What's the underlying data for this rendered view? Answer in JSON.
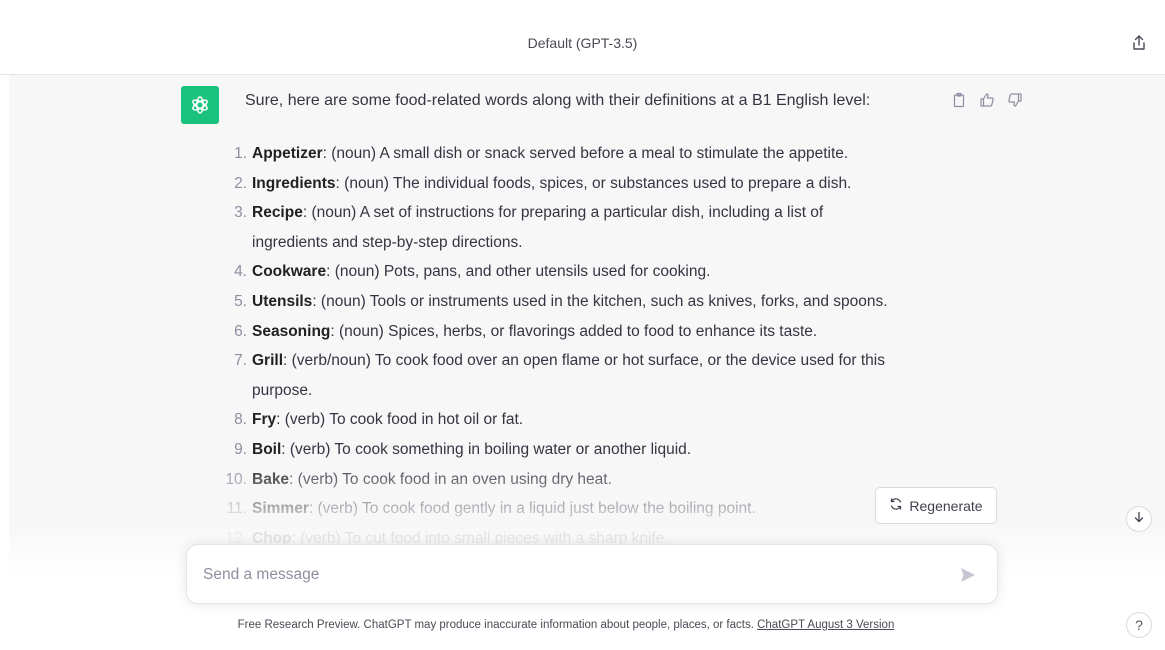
{
  "header": {
    "model_title": "Default (GPT-3.5)",
    "share_icon": "share-icon"
  },
  "message": {
    "avatar_icon": "openai-logo-icon",
    "intro": "Sure, here are some food-related words along with their definitions at a B1 English level:",
    "actions": [
      "clipboard-icon",
      "thumbs-up-icon",
      "thumbs-down-icon"
    ],
    "items": [
      {
        "num": "1.",
        "term": "Appetizer",
        "def": ": (noun) A small dish or snack served before a meal to stimulate the appetite."
      },
      {
        "num": "2.",
        "term": "Ingredients",
        "def": ": (noun) The individual foods, spices, or substances used to prepare a dish."
      },
      {
        "num": "3.",
        "term": "Recipe",
        "def": ": (noun) A set of instructions for preparing a particular dish, including a list of",
        "cont": "ingredients and step-by-step directions."
      },
      {
        "num": "4.",
        "term": "Cookware",
        "def": ": (noun) Pots, pans, and other utensils used for cooking."
      },
      {
        "num": "5.",
        "term": "Utensils",
        "def": ": (noun) Tools or instruments used in the kitchen, such as knives, forks, and spoons."
      },
      {
        "num": "6.",
        "term": "Seasoning",
        "def": ": (noun) Spices, herbs, or flavorings added to food to enhance its taste."
      },
      {
        "num": "7.",
        "term": "Grill",
        "def": ": (verb/noun) To cook food over an open flame or hot surface, or the device used for this",
        "cont": "purpose."
      },
      {
        "num": "8.",
        "term": "Fry",
        "def": ": (verb) To cook food in hot oil or fat."
      },
      {
        "num": "9.",
        "term": "Boil",
        "def": ": (verb) To cook something in boiling water or another liquid."
      },
      {
        "num": "10.",
        "term": "Bake",
        "def": ": (verb) To cook food in an oven using dry heat."
      },
      {
        "num": "11.",
        "term": "Simmer",
        "def": ": (verb) To cook food gently in a liquid just below the boiling point."
      },
      {
        "num": "12.",
        "term": "Chop",
        "def": ": (verb) To cut food into small pieces with a sharp knife."
      }
    ]
  },
  "regenerate": {
    "label": "Regenerate",
    "icon": "refresh-icon"
  },
  "scroll_down_icon": "arrow-down-icon",
  "composer": {
    "placeholder": "Send a message",
    "send_icon": "send-icon"
  },
  "footer": {
    "text": "Free Research Preview. ChatGPT may produce inaccurate information about people, places, or facts. ",
    "link": "ChatGPT August 3 Version"
  },
  "help": {
    "label": "?"
  },
  "colors": {
    "accent": "#19c37d",
    "message_bg": "#f7f7f8",
    "text": "#343541"
  }
}
